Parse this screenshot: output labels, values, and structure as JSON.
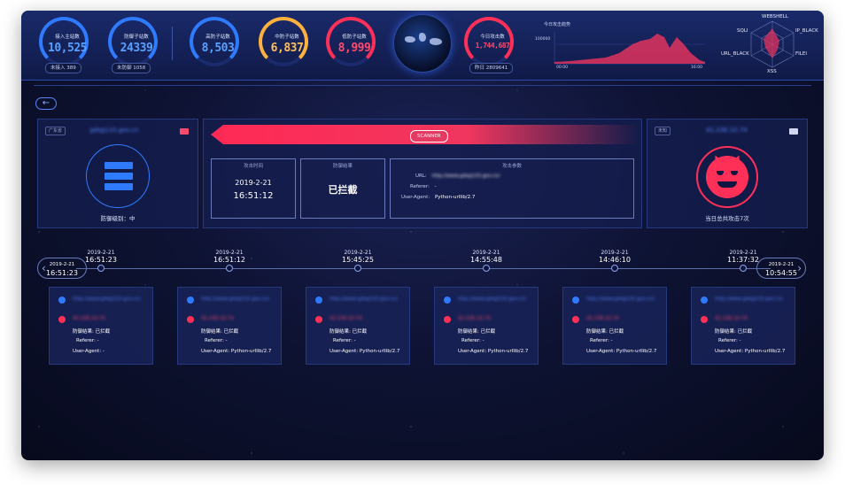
{
  "stats": [
    {
      "label": "接入主站数",
      "value": "10,525",
      "color": "#2f7bff",
      "sub": "未接入 389"
    },
    {
      "label": "防御子站数",
      "value": "24339",
      "color": "#2f7bff",
      "sub": "未防御 1058"
    },
    {
      "label": "高防子站数",
      "value": "8,503",
      "color": "#2f7bff"
    },
    {
      "label": "中防子站数",
      "value": "6,837",
      "color": "#ffb13d"
    },
    {
      "label": "低防子站数",
      "value": "8,999",
      "color": "#ff3057"
    }
  ],
  "attack_today": {
    "label": "今日攻击数",
    "value": "1,744,687",
    "sub": "昨日 2809641",
    "color": "#ff3057"
  },
  "mini_chart": {
    "title": "今日攻击趋势",
    "y_label": "100000",
    "x_start": "00:00",
    "x_end": "16:00"
  },
  "radar": {
    "labels": [
      "WEBSHELL",
      "IP_BLACK",
      "FILEI",
      "XSS",
      "URL_BLACK",
      "SQLI"
    ]
  },
  "site_panel": {
    "tag": "广东省",
    "domain": "gdsg110.gov.cn",
    "defense_level": "防御级别：中"
  },
  "attack_panel": {
    "scanner_label": "SCANNER",
    "time_title": "攻击时间",
    "date": "2019-2-21",
    "time": "16:51:12",
    "result_title": "防御结果",
    "result": "已拦截",
    "params_title": "攻击参数",
    "url_key": "URL:",
    "url_val": "http://www.gdsg110.gov.cn/",
    "referer_key": "Referer:",
    "referer_val": "-",
    "ua_key": "User-Agent:",
    "ua_val": "Python-urllib/2.7"
  },
  "attacker_panel": {
    "tag": "未知",
    "ip": "42.236.10.74",
    "summary": "当日总共攻击7次"
  },
  "timeline": {
    "prev": {
      "date": "2019-2-21",
      "time": "16:51:23"
    },
    "next": {
      "date": "2019-2-21",
      "time": "10:54:55"
    },
    "ticks": [
      {
        "date": "2019-2-21",
        "time": "16:51:23"
      },
      {
        "date": "2019-2-21",
        "time": "16:51:12"
      },
      {
        "date": "2019-2-21",
        "time": "15:45:25"
      },
      {
        "date": "2019-2-21",
        "time": "14:55:48"
      },
      {
        "date": "2019-2-21",
        "time": "14:46:10"
      },
      {
        "date": "2019-2-21",
        "time": "11:37:32"
      }
    ]
  },
  "cards": [
    {
      "url": "http://www.gdsg110.gov.cn/",
      "ip": "42.236.10.74",
      "result": "防御结果: 已拦截",
      "referer": "Referer: -",
      "ua": "User-Agent: -"
    },
    {
      "url": "http://www.gdsg110.gov.cn/",
      "ip": "42.236.10.74",
      "result": "防御结果: 已拦截",
      "referer": "Referer: -",
      "ua": "User-Agent: Python-urllib/2.7"
    },
    {
      "url": "http://www.gdsg110.gov.cn/",
      "ip": "42.236.10.74",
      "result": "防御结果: 已拦截",
      "referer": "Referer: -",
      "ua": "User-Agent: Python-urllib/2.7"
    },
    {
      "url": "http://www.gdsg110.gov.cn/",
      "ip": "42.236.10.74",
      "result": "防御结果: 已拦截",
      "referer": "Referer: -",
      "ua": "User-Agent: Python-urllib/2.7"
    },
    {
      "url": "http://www.gdsg110.gov.cn/",
      "ip": "42.236.10.74",
      "result": "防御结果: 已拦截",
      "referer": "Referer: -",
      "ua": "User-Agent: Python-urllib/2.7"
    },
    {
      "url": "http://www.gdsg110.gov.cn/",
      "ip": "42.236.10.74",
      "result": "防御结果: 已拦截",
      "referer": "Referer: -",
      "ua": "User-Agent: Python-urllib/2.7"
    }
  ]
}
